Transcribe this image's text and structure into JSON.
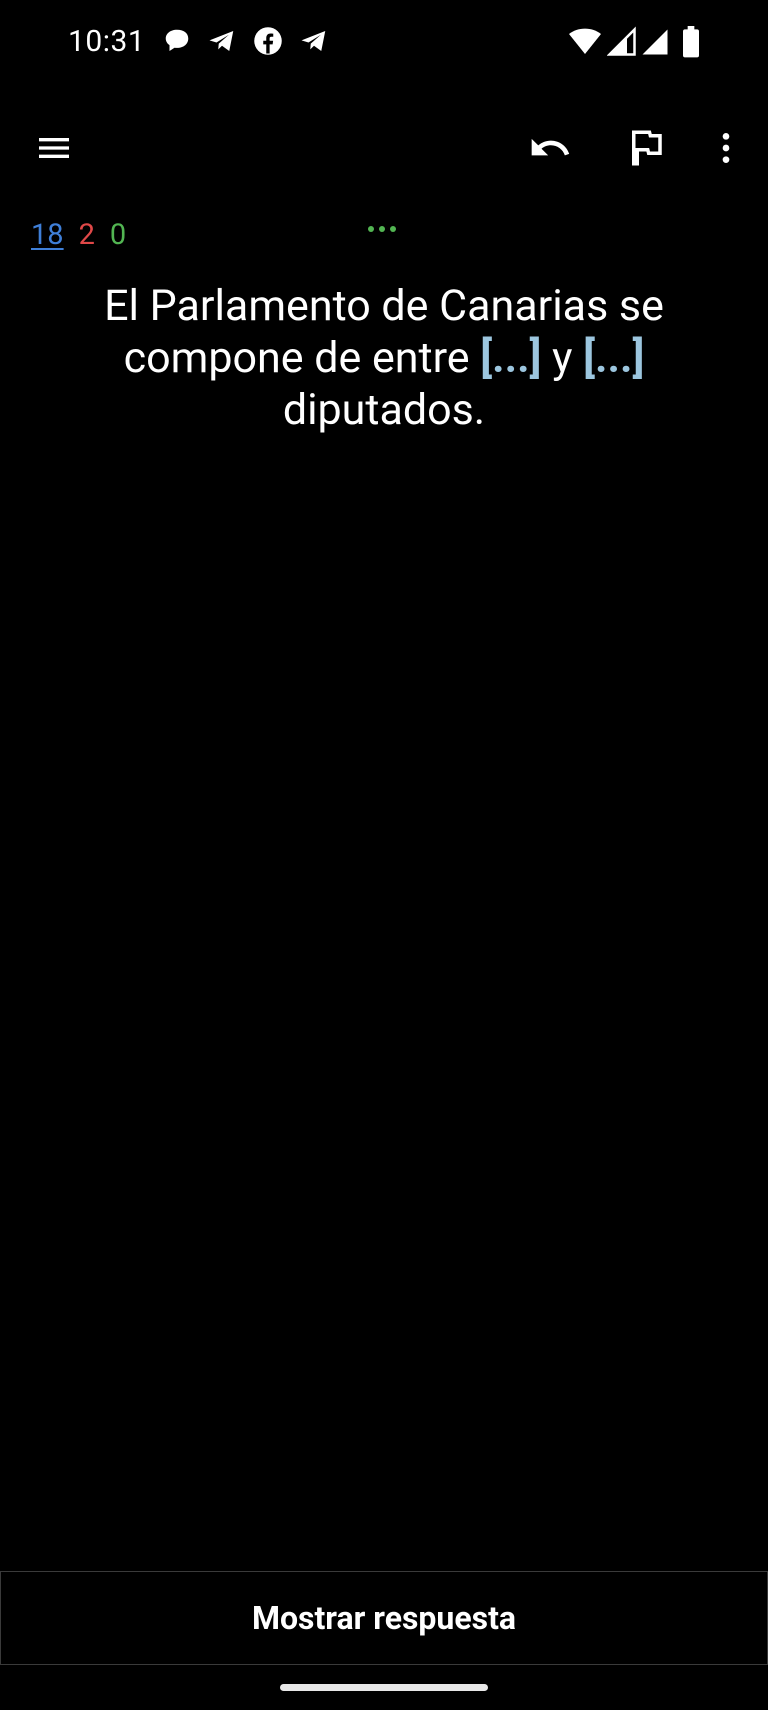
{
  "status_bar": {
    "time": "10:31",
    "notification_icons": [
      "chat-bubble-icon",
      "telegram-icon",
      "facebook-icon",
      "telegram-icon"
    ],
    "system_icons": [
      "wifi-icon",
      "signal-icon",
      "signal-icon",
      "battery-icon"
    ]
  },
  "toolbar": {
    "icons": [
      "menu-icon",
      "undo-icon",
      "flag-icon",
      "more-vert-icon"
    ]
  },
  "counts": {
    "new": "18",
    "learning": "2",
    "review": "0"
  },
  "card": {
    "part1": "El Parlamento de Canarias se compone de entre ",
    "cloze1": "[...]",
    "part2": " y ",
    "cloze2": "[...]",
    "part3": " diputados."
  },
  "bottom": {
    "show_answer": "Mostrar respuesta"
  },
  "colors": {
    "background": "#000000",
    "new_count": "#3f7fd8",
    "learning_count": "#e04848",
    "review_count": "#52b552",
    "cloze": "#9cc6df"
  }
}
